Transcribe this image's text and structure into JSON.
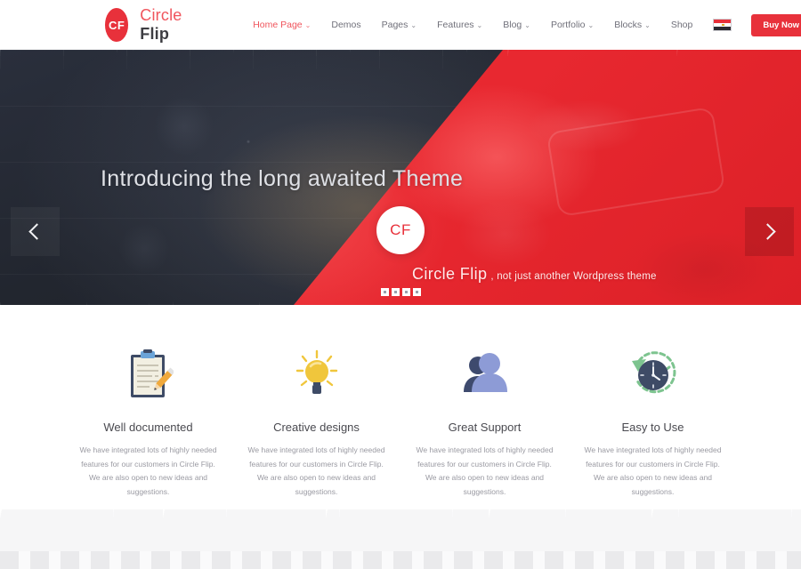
{
  "header": {
    "logo": {
      "badge_text": "CF",
      "name_part1": "Circle",
      "name_part2": "Flip"
    },
    "nav": [
      {
        "label": "Home Page",
        "caret": "⌄",
        "active": true
      },
      {
        "label": "Demos",
        "caret": "",
        "active": false
      },
      {
        "label": "Pages",
        "caret": "⌄",
        "active": false
      },
      {
        "label": "Features",
        "caret": "⌄",
        "active": false
      },
      {
        "label": "Blog",
        "caret": "⌄",
        "active": false
      },
      {
        "label": "Portfolio",
        "caret": "⌄",
        "active": false
      },
      {
        "label": "Blocks",
        "caret": "⌄",
        "active": false
      },
      {
        "label": "Shop",
        "caret": "",
        "active": false
      }
    ],
    "flag_icon": "egypt-flag-icon",
    "buy_button": "Buy Now"
  },
  "hero": {
    "title": "Introducing the long awaited Theme",
    "badge_text": "CF",
    "subtitle_brand": "Circle Flip",
    "subtitle_rest": ", not just another Wordpress theme",
    "prev_icon": "chevron-left-icon",
    "next_icon": "chevron-right-icon",
    "dots": [
      1,
      2,
      3,
      4
    ],
    "active_dot": 1,
    "colors": {
      "red": "#e8313b",
      "dark": "#262b36"
    }
  },
  "features": [
    {
      "icon": "clipboard-pencil-icon",
      "title": "Well documented",
      "desc": "We have integrated lots of highly needed features for our customers in Circle Flip. We are also open to new ideas and suggestions."
    },
    {
      "icon": "lightbulb-icon",
      "title": "Creative designs",
      "desc": "We have integrated lots of highly needed features for our customers in Circle Flip. We are also open to new ideas and suggestions."
    },
    {
      "icon": "users-icon",
      "title": "Great Support",
      "desc": "We have integrated lots of highly needed features for our customers in Circle Flip. We are also open to new ideas and suggestions."
    },
    {
      "icon": "clock-refresh-icon",
      "title": "Easy to Use",
      "desc": "We have integrated lots of highly needed features for our customers in Circle Flip. We are also open to new ideas and suggestions."
    }
  ]
}
